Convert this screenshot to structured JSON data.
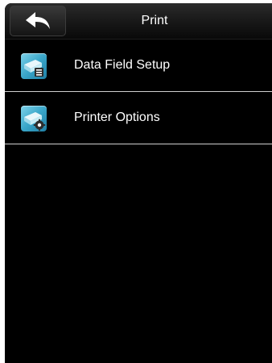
{
  "header": {
    "title": "Print",
    "back_icon": "back-arrow-icon"
  },
  "menu": {
    "items": [
      {
        "label": "Data Field Setup",
        "icon": "printer-data-field-icon"
      },
      {
        "label": "Printer Options",
        "icon": "printer-options-icon"
      }
    ]
  },
  "colors": {
    "background": "#000000",
    "header": "#1a1a1a",
    "divider": "#cfcfcf",
    "text": "#ffffff",
    "icon_accent": "#3aa6c9"
  }
}
